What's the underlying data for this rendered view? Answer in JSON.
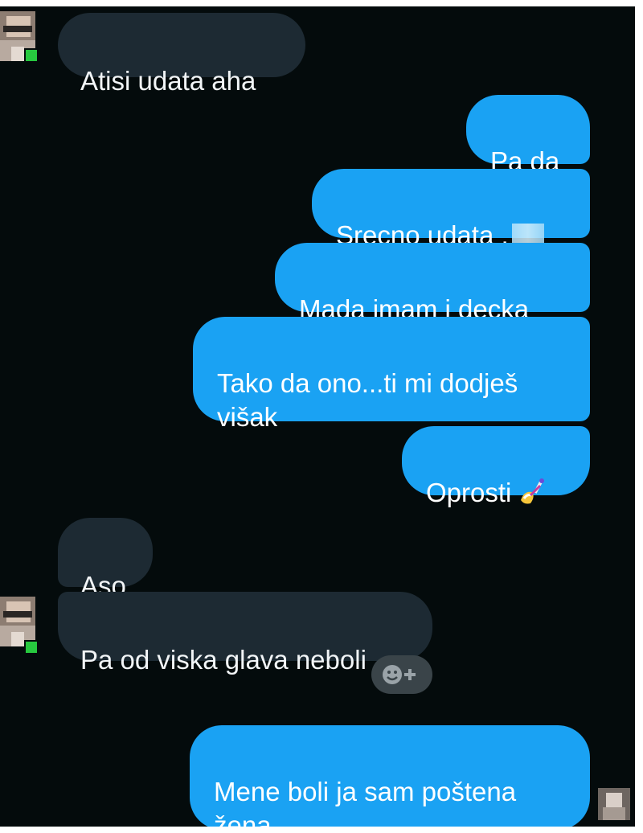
{
  "chat": {
    "messages": [
      {
        "side": "incoming",
        "text": "Atisi udata aha"
      },
      {
        "side": "outgoing",
        "text": "Pa da"
      },
      {
        "side": "outgoing",
        "text": "Srecno udata ,"
      },
      {
        "side": "outgoing",
        "text": "Mada imam i decka"
      },
      {
        "side": "outgoing",
        "text": "Tako da ono...ti mi dodješ\nvišak"
      },
      {
        "side": "outgoing",
        "text": "Oprosti"
      },
      {
        "side": "incoming",
        "text": "Aso"
      },
      {
        "side": "incoming",
        "text": "Pa od viska glava neboli"
      },
      {
        "side": "outgoing",
        "text": "Mene boli ja sam poštena\nžena"
      }
    ],
    "reaction_button": {
      "icon": "add-reaction-icon"
    },
    "emoji_after_oprosti": "nail-polish-icon"
  },
  "colors": {
    "background": "#040b0c",
    "incoming_bubble": "#1d2a33",
    "outgoing_bubble": "#1aa2f3",
    "online_dot": "#27c93f"
  }
}
